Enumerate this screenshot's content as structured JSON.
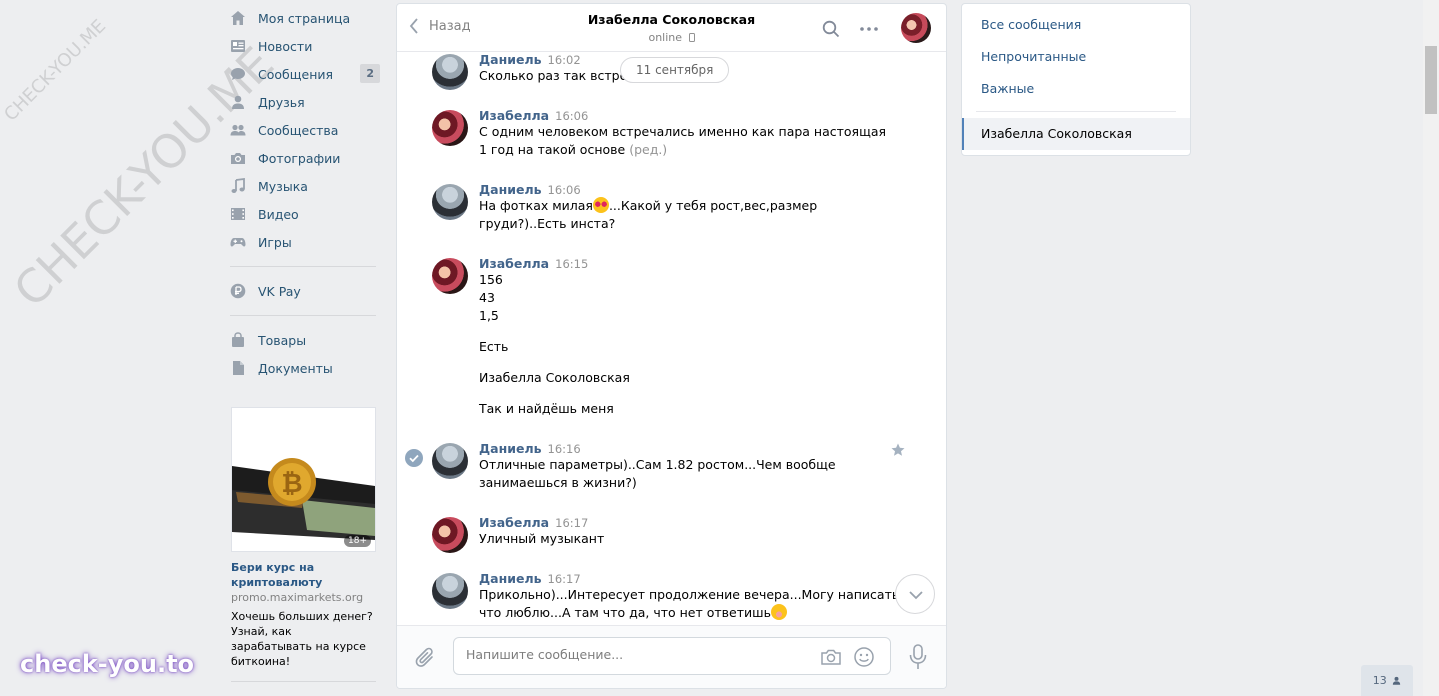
{
  "nav": {
    "items": [
      {
        "label": "Моя страница",
        "icon": "home-icon"
      },
      {
        "label": "Новости",
        "icon": "news-icon"
      },
      {
        "label": "Сообщения",
        "icon": "messages-icon",
        "badge": "2"
      },
      {
        "label": "Друзья",
        "icon": "user-icon"
      },
      {
        "label": "Сообщества",
        "icon": "group-icon"
      },
      {
        "label": "Фотографии",
        "icon": "camera-icon"
      },
      {
        "label": "Музыка",
        "icon": "music-icon"
      },
      {
        "label": "Видео",
        "icon": "video-icon"
      },
      {
        "label": "Игры",
        "icon": "gamepad-icon"
      }
    ],
    "vkpay": {
      "label": "VK Pay",
      "icon": "ruble-icon"
    },
    "extra": [
      {
        "label": "Товары",
        "icon": "bag-icon"
      },
      {
        "label": "Документы",
        "icon": "document-icon"
      }
    ]
  },
  "ad": {
    "age": "18+",
    "title": "Бери курс на криптовалюту",
    "domain": "promo.maximarkets.org",
    "text": "Хочешь больших денег? Узнай, как зарабатывать на курсе биткоина!"
  },
  "chat": {
    "back_label": "Назад",
    "peer_name": "Изабелла Соколовская",
    "peer_status": "online",
    "date_pill": "11 сентября",
    "messages": [
      {
        "author": "Даниель",
        "time": "16:02",
        "text": "Сколько раз так встреча"
      },
      {
        "author": "Изабелла",
        "time": "16:06",
        "text": "С одним человеком встречались именно как пара настоящая\n1 год на такой основе",
        "edited": "(ред.)"
      },
      {
        "author": "Даниель",
        "time": "16:06",
        "text_before": "На фотках милая",
        "text_after": "...Какой у тебя рост,вес,размер\nгруди?)..Есть инста?"
      },
      {
        "author": "Изабелла",
        "time": "16:15",
        "lines": [
          "156\n43\n1,5",
          "Есть",
          "Изабелла Соколовская",
          "Так и найдёшь меня"
        ]
      },
      {
        "author": "Даниель",
        "time": "16:16",
        "text": "Отличные параметры)..Сам 1.82 ростом...Чем вообще\nзанимаешься в жизни?)"
      },
      {
        "author": "Изабелла",
        "time": "16:17",
        "text": "Уличный музыкант"
      },
      {
        "author": "Даниель",
        "time": "16:17",
        "text_before": "Прикольно)...Интересует продолжение вечера...Могу написать\nчто люблю...А там что да, что нет ответишь"
      }
    ],
    "input_placeholder": "Напишите сообщение..."
  },
  "filters": {
    "items": [
      "Все сообщения",
      "Непрочитанные",
      "Важные"
    ],
    "active": "Изабелла Соколовская"
  },
  "footer_badge": "13",
  "watermarks": {
    "small": "CHECK-YOU.ME",
    "large": "CHECK-YOU.ME",
    "logo": "check-you.to"
  },
  "colors": {
    "link": "#2a5885",
    "author": "#42648b",
    "accent": "#5181b8",
    "background": "#edeef0"
  }
}
